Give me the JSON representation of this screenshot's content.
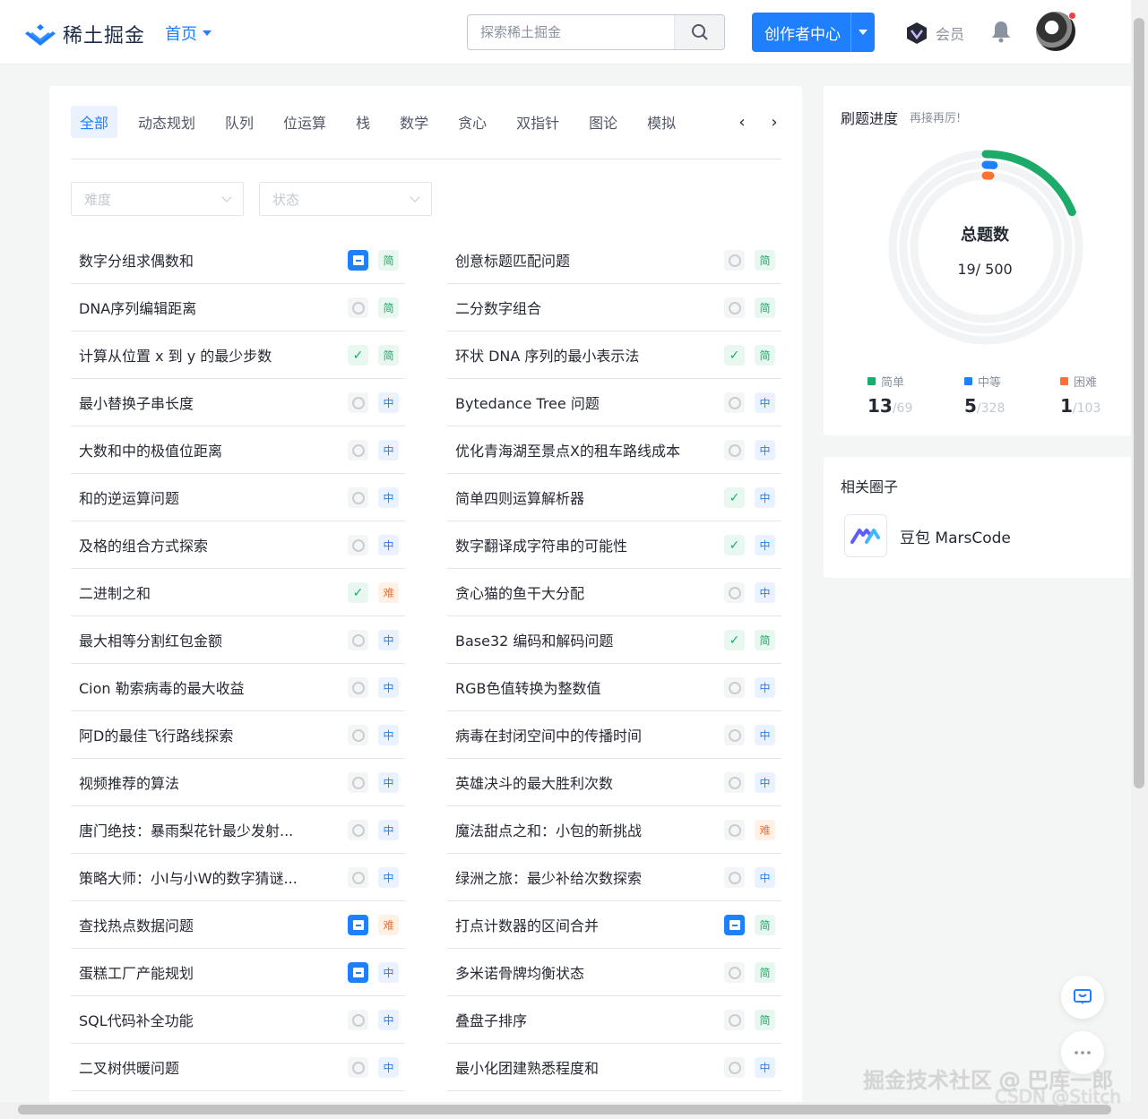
{
  "header": {
    "logo_text": "稀土掘金",
    "nav_home": "首页",
    "search_placeholder": "探索稀土掘金",
    "creator_label": "创作者中心",
    "member_label": "会员"
  },
  "tabs": [
    "全部",
    "动态规划",
    "队列",
    "位运算",
    "栈",
    "数学",
    "贪心",
    "双指针",
    "图论",
    "模拟"
  ],
  "filters": {
    "difficulty": "难度",
    "status": "状态"
  },
  "problems_left": [
    {
      "title": "数字分组求偶数和",
      "status": "note",
      "diff": "简"
    },
    {
      "title": "DNA序列编辑距离",
      "status": "none",
      "diff": "简"
    },
    {
      "title": "计算从位置 x 到 y 的最少步数",
      "status": "done",
      "diff": "简"
    },
    {
      "title": "最小替换子串长度",
      "status": "none",
      "diff": "中"
    },
    {
      "title": "大数和中的极值位距离",
      "status": "none",
      "diff": "中"
    },
    {
      "title": "和的逆运算问题",
      "status": "none",
      "diff": "中"
    },
    {
      "title": "及格的组合方式探索",
      "status": "none",
      "diff": "中"
    },
    {
      "title": "二进制之和",
      "status": "done",
      "diff": "难"
    },
    {
      "title": "最大相等分割红包金额",
      "status": "none",
      "diff": "中"
    },
    {
      "title": "Cion 勒索病毒的最大收益",
      "status": "none",
      "diff": "中"
    },
    {
      "title": "阿D的最佳飞行路线探索",
      "status": "none",
      "diff": "中"
    },
    {
      "title": "视频推荐的算法",
      "status": "none",
      "diff": "中"
    },
    {
      "title": "唐门绝技：暴雨梨花针最少发射...",
      "status": "none",
      "diff": "中"
    },
    {
      "title": "策略大师：小I与小W的数字猜谜...",
      "status": "none",
      "diff": "中"
    },
    {
      "title": "查找热点数据问题",
      "status": "note",
      "diff": "难"
    },
    {
      "title": "蛋糕工厂产能规划",
      "status": "note",
      "diff": "中"
    },
    {
      "title": "SQL代码补全功能",
      "status": "none",
      "diff": "中"
    },
    {
      "title": "二叉树供暖问题",
      "status": "none",
      "diff": "中"
    }
  ],
  "problems_right": [
    {
      "title": "创意标题匹配问题",
      "status": "none",
      "diff": "简"
    },
    {
      "title": "二分数字组合",
      "status": "none",
      "diff": "简"
    },
    {
      "title": "环状 DNA 序列的最小表示法",
      "status": "done",
      "diff": "简"
    },
    {
      "title": "Bytedance Tree 问题",
      "status": "none",
      "diff": "中"
    },
    {
      "title": "优化青海湖至景点X的租车路线成本",
      "status": "none",
      "diff": "中"
    },
    {
      "title": "简单四则运算解析器",
      "status": "done",
      "diff": "中"
    },
    {
      "title": "数字翻译成字符串的可能性",
      "status": "done",
      "diff": "中"
    },
    {
      "title": "贪心猫的鱼干大分配",
      "status": "none",
      "diff": "中"
    },
    {
      "title": "Base32 编码和解码问题",
      "status": "done",
      "diff": "简"
    },
    {
      "title": "RGB色值转换为整数值",
      "status": "none",
      "diff": "中"
    },
    {
      "title": "病毒在封闭空间中的传播时间",
      "status": "none",
      "diff": "中"
    },
    {
      "title": "英雄决斗的最大胜利次数",
      "status": "none",
      "diff": "中"
    },
    {
      "title": "魔法甜点之和：小包的新挑战",
      "status": "none",
      "diff": "难"
    },
    {
      "title": "绿洲之旅：最少补给次数探索",
      "status": "none",
      "diff": "中"
    },
    {
      "title": "打点计数器的区间合并",
      "status": "note",
      "diff": "简"
    },
    {
      "title": "多米诺骨牌均衡状态",
      "status": "none",
      "diff": "简"
    },
    {
      "title": "叠盘子排序",
      "status": "none",
      "diff": "简"
    },
    {
      "title": "最小化团建熟悉程度和",
      "status": "none",
      "diff": "中"
    }
  ],
  "progress": {
    "title": "刷题进度",
    "subtitle": "再接再厉!",
    "ring_title": "总题数",
    "total_label": "19/ 500",
    "solved": 19,
    "total": 500,
    "easy": {
      "label": "简单",
      "done": "13",
      "total": "/69",
      "color": "#1dab6a"
    },
    "medium": {
      "label": "中等",
      "done": "5",
      "total": "/328",
      "color": "#1e80ff"
    },
    "hard": {
      "label": "困难",
      "done": "1",
      "total": "/103",
      "color": "#f77234"
    }
  },
  "circle": {
    "title": "相关圈子",
    "name": "豆包 MarsCode"
  },
  "watermark": "掘金技术社区 @ 巴库一郎",
  "watermark2": "CSDN @Stitch"
}
